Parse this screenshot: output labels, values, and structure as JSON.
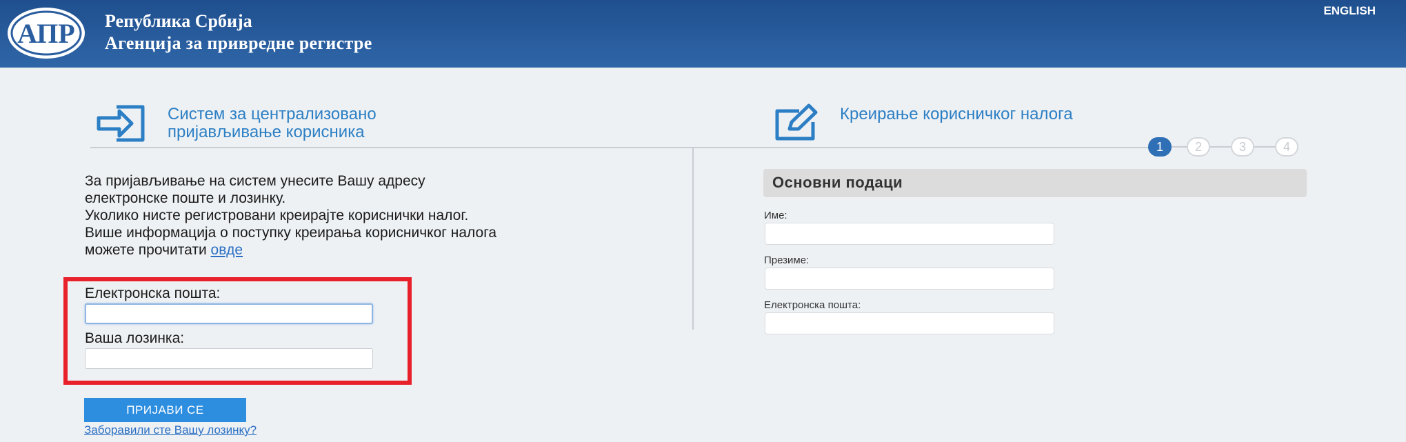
{
  "header": {
    "logo_text": "АПР",
    "org_line1": "Република Србија",
    "org_line2": "Агенција за привредне регистре",
    "language_link": "ENGLISH"
  },
  "login": {
    "title_line1": "Систем за централизовано",
    "title_line2": "пријављивање корисника",
    "icon": "login-arrow-icon",
    "intro_line1": "За пријављивање на систем унесите Вашу адресу",
    "intro_line2": "електронске поште и лозинку.",
    "intro_line3": "Уколико нисте регистровани креирајте кориснички налог.",
    "intro_line4": "Више информација о поступку креирања корисничког налога",
    "intro_line5": "можете прочитати",
    "intro_link": "овде",
    "email_label": "Електронска пошта:",
    "email_value": "",
    "password_label": "Ваша лозинка:",
    "password_value": "",
    "submit_label": "ПРИЈАВИ СЕ",
    "forgot_link": "Заборавили сте Вашу лозинку?",
    "highlight_color": "#e8202a"
  },
  "register": {
    "title": "Креирање корисничког налога",
    "icon": "edit-form-icon",
    "steps": [
      "1",
      "2",
      "3",
      "4"
    ],
    "active_step": 1,
    "section_title": "Основни подаци",
    "fields": [
      {
        "label": "Име:",
        "value": ""
      },
      {
        "label": "Презиме:",
        "value": ""
      },
      {
        "label": "Електронска пошта:",
        "value": ""
      }
    ]
  },
  "colors": {
    "header_bg": "#2a5d9f",
    "accent": "#2c7fc4",
    "button": "#2d8ee0"
  }
}
